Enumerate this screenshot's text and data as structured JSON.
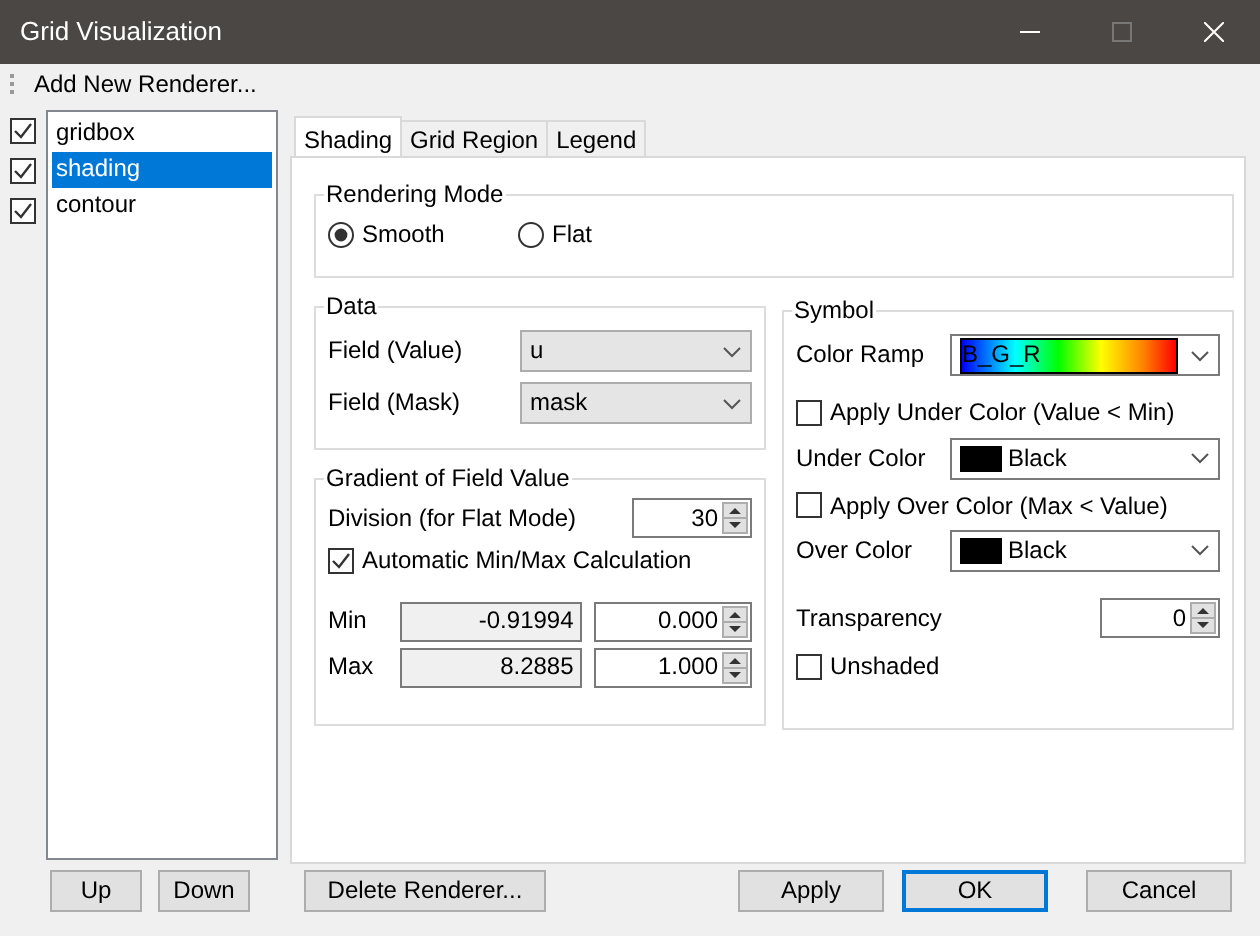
{
  "window": {
    "title": "Grid Visualization"
  },
  "toolbar": {
    "add_button": "Add New Renderer..."
  },
  "renderers": [
    {
      "label": "gridbox",
      "checked": true,
      "selected": false
    },
    {
      "label": "shading",
      "checked": true,
      "selected": true
    },
    {
      "label": "contour",
      "checked": true,
      "selected": false
    }
  ],
  "tabs": [
    {
      "label": "Shading",
      "selected": true
    },
    {
      "label": "Grid Region",
      "selected": false
    },
    {
      "label": "Legend",
      "selected": false
    }
  ],
  "rendering_mode": {
    "title": "Rendering Mode",
    "options": [
      {
        "label": "Smooth",
        "selected": true
      },
      {
        "label": "Flat",
        "selected": false
      }
    ]
  },
  "data": {
    "title": "Data",
    "fields": [
      {
        "label": "Field (Value)",
        "value": "u"
      },
      {
        "label": "Field (Mask)",
        "value": "mask"
      }
    ]
  },
  "gradient": {
    "title": "Gradient of Field Value",
    "division": {
      "label": "Division (for Flat Mode)",
      "value": "30"
    },
    "auto": {
      "label": "Automatic Min/Max Calculation",
      "checked": true
    },
    "rows": [
      {
        "label": "Min",
        "computed": "-0.91994",
        "value": "0.000"
      },
      {
        "label": "Max",
        "computed": "8.2885",
        "value": "1.000"
      }
    ]
  },
  "symbol": {
    "title": "Symbol",
    "color_ramp": {
      "label": "Color Ramp",
      "value": "B_G_R"
    },
    "apply_under": {
      "label": "Apply Under Color (Value < Min)",
      "checked": false
    },
    "under_color": {
      "label": "Under Color",
      "value": "Black",
      "color": "#000000"
    },
    "apply_over": {
      "label": "Apply Over Color (Max < Value)",
      "checked": false
    },
    "over_color": {
      "label": "Over Color",
      "value": "Black",
      "color": "#000000"
    },
    "transparency": {
      "label": "Transparency",
      "value": "0"
    },
    "unshaded": {
      "label": "Unshaded",
      "checked": false
    }
  },
  "list_buttons": [
    "Up",
    "Down"
  ],
  "delete_button": "Delete Renderer...",
  "dialog_buttons": [
    {
      "label": "Apply",
      "default": false
    },
    {
      "label": "OK",
      "default": true
    },
    {
      "label": "Cancel",
      "default": false
    }
  ]
}
